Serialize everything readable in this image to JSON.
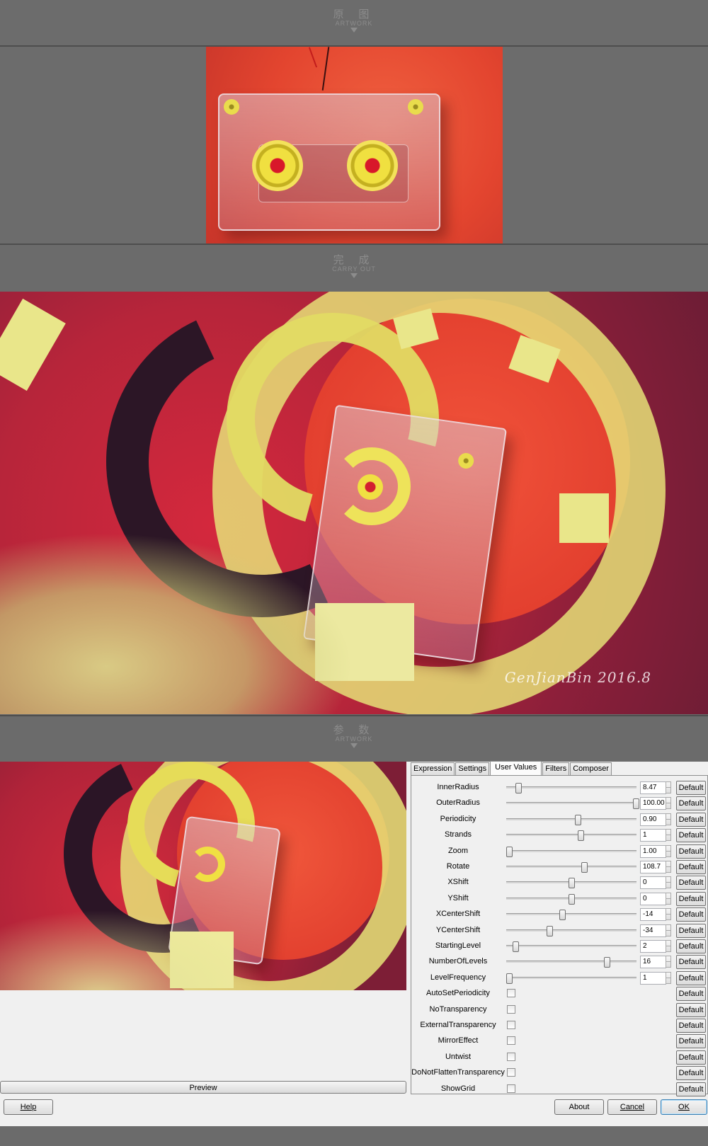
{
  "sections": [
    {
      "cn": "原 图",
      "en": "ARTWORK"
    },
    {
      "cn": "完 成",
      "en": "CARRY OUT"
    },
    {
      "cn": "参 数",
      "en": "ARTWORK"
    }
  ],
  "signature": "GenJianBin 2016.8",
  "dialog": {
    "tabs": [
      "Expression",
      "Settings",
      "User Values",
      "Filters",
      "Composer"
    ],
    "active_tab": "User Values",
    "default_label": "Default",
    "sliders": [
      {
        "label": "InnerRadius",
        "value": "8.47",
        "pos": 0.09
      },
      {
        "label": "OuterRadius",
        "value": "100.00",
        "pos": 0.995
      },
      {
        "label": "Periodicity",
        "value": "0.90",
        "pos": 0.55
      },
      {
        "label": "Strands",
        "value": "1",
        "pos": 0.57
      },
      {
        "label": "Zoom",
        "value": "1.00",
        "pos": 0.02
      },
      {
        "label": "Rotate",
        "value": "108.7",
        "pos": 0.6
      },
      {
        "label": "XShift",
        "value": "0",
        "pos": 0.5
      },
      {
        "label": "YShift",
        "value": "0",
        "pos": 0.5
      },
      {
        "label": "XCenterShift",
        "value": "-14",
        "pos": 0.43
      },
      {
        "label": "YCenterShift",
        "value": "-34",
        "pos": 0.33
      },
      {
        "label": "StartingLevel",
        "value": "2",
        "pos": 0.07
      },
      {
        "label": "NumberOfLevels",
        "value": "16",
        "pos": 0.77
      },
      {
        "label": "LevelFrequency",
        "value": "1",
        "pos": 0.02
      }
    ],
    "checkboxes": [
      {
        "label": "AutoSetPeriodicity",
        "checked": false
      },
      {
        "label": "NoTransparency",
        "checked": false
      },
      {
        "label": "ExternalTransparency",
        "checked": false
      },
      {
        "label": "MirrorEffect",
        "checked": false
      },
      {
        "label": "Untwist",
        "checked": false
      },
      {
        "label": "DoNotFlattenTransparency",
        "checked": false
      },
      {
        "label": "ShowGrid",
        "checked": false
      }
    ],
    "preview_label": "Preview",
    "help_label": "Help",
    "about_label": "About",
    "cancel_label": "Cancel",
    "ok_label": "OK"
  },
  "colors": {
    "background": "#6b6b6b",
    "accent_red": "#e3452f",
    "accent_yellow": "#e9e68a"
  }
}
